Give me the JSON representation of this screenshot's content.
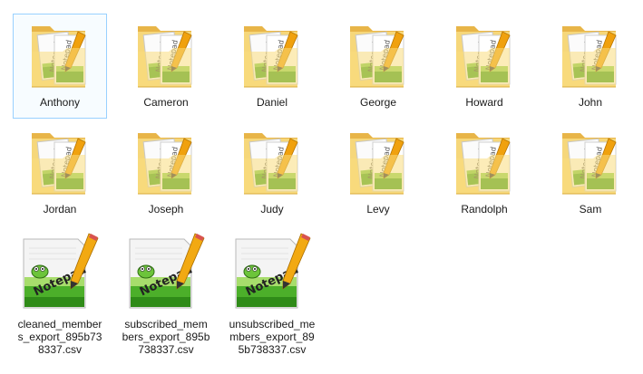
{
  "folders": [
    {
      "name": "Anthony",
      "selected": true
    },
    {
      "name": "Cameron"
    },
    {
      "name": "Daniel"
    },
    {
      "name": "George"
    },
    {
      "name": "Howard"
    },
    {
      "name": "John"
    },
    {
      "name": "Jordan"
    },
    {
      "name": "Joseph"
    },
    {
      "name": "Judy"
    },
    {
      "name": "Levy"
    },
    {
      "name": "Randolph"
    },
    {
      "name": "Sam"
    }
  ],
  "files": [
    {
      "name": "cleaned_members_export_895b738337.csv",
      "icon": "notepadpp-file-icon"
    },
    {
      "name": "subscribed_members_export_895b738337.csv",
      "icon": "notepadpp-file-icon"
    },
    {
      "name": "unsubscribed_members_export_895b738337.csv",
      "icon": "notepadpp-file-icon"
    }
  ],
  "icons": {
    "folder": "folder-icon",
    "folder_color": "#f4d36d",
    "accent_green": "#4caf2a",
    "selection_border": "#99d1ff"
  }
}
